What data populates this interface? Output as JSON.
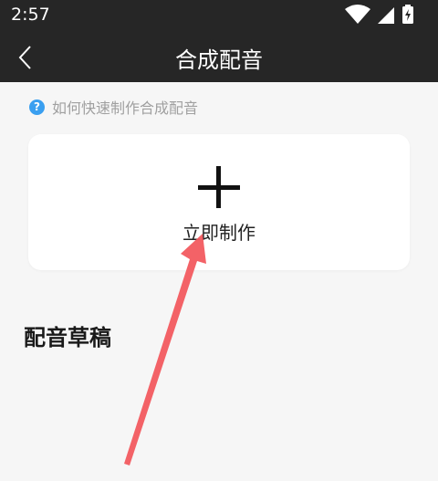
{
  "status_bar": {
    "time": "2:57",
    "icons": [
      "wifi-icon",
      "cellular-signal-icon",
      "battery-charging-icon"
    ]
  },
  "app_bar": {
    "title": "合成配音",
    "back_icon": "chevron-left-icon"
  },
  "help": {
    "icon": "question-circle-icon",
    "text": "如何快速制作合成配音"
  },
  "create_card": {
    "icon": "plus-icon",
    "label": "立即制作"
  },
  "drafts": {
    "title": "配音草稿"
  },
  "annotation": {
    "arrow_color": "#f25a5f"
  },
  "colors": {
    "header_bg": "#262626",
    "page_bg": "#f6f6f6",
    "help_icon": "#3a9ff0"
  }
}
